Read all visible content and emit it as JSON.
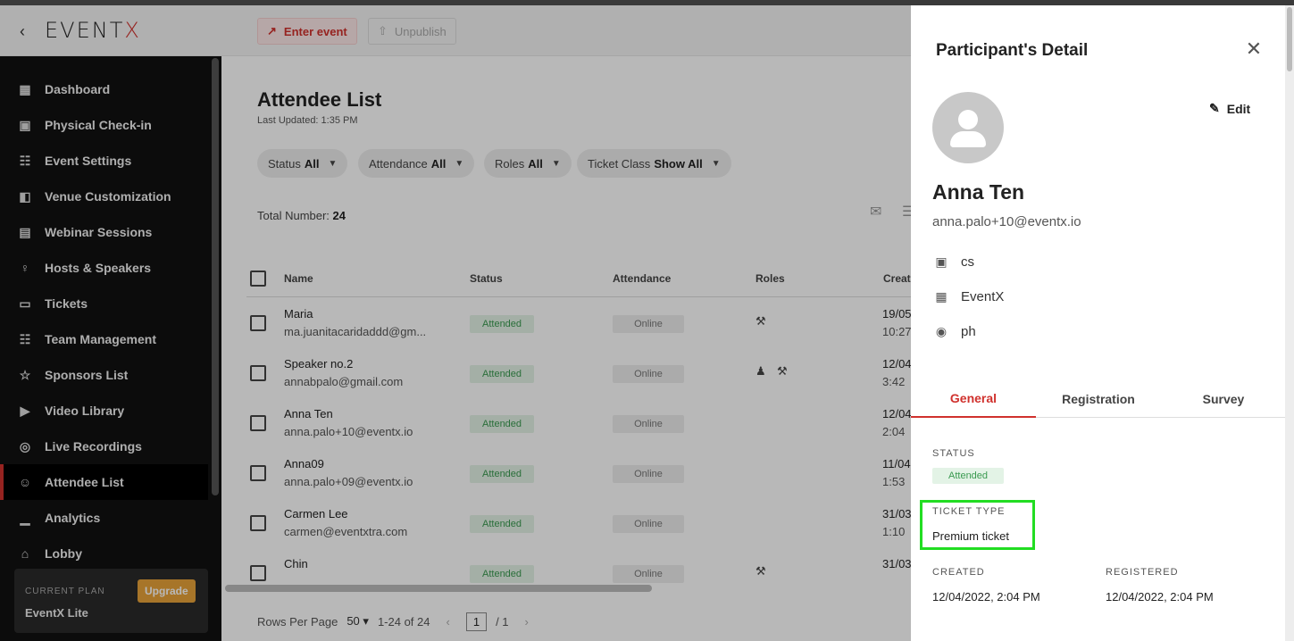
{
  "topbar": {
    "logo_main": "EVENT",
    "logo_x": "X",
    "enter_event_label": "Enter event",
    "unpublish_label": "Unpublish"
  },
  "sidebar": {
    "items": [
      {
        "label": "Dashboard",
        "icon": "dashboard-icon"
      },
      {
        "label": "Physical Check-in",
        "icon": "qr-code-icon"
      },
      {
        "label": "Event Settings",
        "icon": "calendar-settings-icon"
      },
      {
        "label": "Venue Customization",
        "icon": "layout-icon"
      },
      {
        "label": "Webinar Sessions",
        "icon": "calendar-icon"
      },
      {
        "label": "Hosts & Speakers",
        "icon": "microphone-icon"
      },
      {
        "label": "Tickets",
        "icon": "ticket-icon"
      },
      {
        "label": "Team Management",
        "icon": "team-icon"
      },
      {
        "label": "Sponsors List",
        "icon": "sponsor-icon"
      },
      {
        "label": "Video Library",
        "icon": "video-library-icon"
      },
      {
        "label": "Live Recordings",
        "icon": "record-icon"
      },
      {
        "label": "Attendee List",
        "icon": "users-icon"
      },
      {
        "label": "Analytics",
        "icon": "bar-chart-icon"
      },
      {
        "label": "Lobby",
        "icon": "lobby-icon"
      }
    ],
    "active_index": 11,
    "plan_label": "CURRENT PLAN",
    "plan_name": "EventX Lite",
    "upgrade_label": "Upgrade"
  },
  "main": {
    "title": "Attendee List",
    "last_updated": "Last Updated: 1:35 PM",
    "filters": [
      {
        "label": "Status",
        "value": "All"
      },
      {
        "label": "Attendance",
        "value": "All"
      },
      {
        "label": "Roles",
        "value": "All"
      },
      {
        "label": "Ticket Class",
        "value": "Show All"
      }
    ],
    "total_label": "Total Number:",
    "total_value": "24",
    "columns": [
      "Name",
      "Status",
      "Attendance",
      "Roles",
      "Creat"
    ],
    "rows": [
      {
        "name": "Maria",
        "email": "ma.juanitacaridaddd@gm...",
        "status": "Attended",
        "attendance": "Online",
        "roles": [
          "key-icon"
        ],
        "date": "19/05",
        "time": "10:27"
      },
      {
        "name": "Speaker no.2",
        "email": "annabpalo@gmail.com",
        "status": "Attended",
        "attendance": "Online",
        "roles": [
          "speaker-icon",
          "key-icon"
        ],
        "date": "12/04",
        "time": "3:42"
      },
      {
        "name": "Anna Ten",
        "email": "anna.palo+10@eventx.io",
        "status": "Attended",
        "attendance": "Online",
        "roles": [],
        "date": "12/04",
        "time": "2:04"
      },
      {
        "name": "Anna09",
        "email": "anna.palo+09@eventx.io",
        "status": "Attended",
        "attendance": "Online",
        "roles": [],
        "date": "11/04",
        "time": "1:53"
      },
      {
        "name": "Carmen Lee",
        "email": "carmen@eventxtra.com",
        "status": "Attended",
        "attendance": "Online",
        "roles": [],
        "date": "31/03",
        "time": "1:10"
      },
      {
        "name": "Chin",
        "email": "",
        "status": "Attended",
        "attendance": "Online",
        "roles": [
          "key-icon"
        ],
        "date": "31/03",
        "time": ""
      }
    ],
    "pager": {
      "rows_per_page_label": "Rows Per Page",
      "rows_per_page": "50",
      "range": "1-24 of 24",
      "page": "1",
      "of_pages": "/ 1"
    }
  },
  "drawer": {
    "title": "Participant's Detail",
    "edit_label": "Edit",
    "name": "Anna Ten",
    "email": "anna.palo+10@eventx.io",
    "info": [
      {
        "icon": "id-card-icon",
        "value": "cs"
      },
      {
        "icon": "building-icon",
        "value": "EventX"
      },
      {
        "icon": "location-pin-icon",
        "value": "ph"
      }
    ],
    "tabs": [
      "General",
      "Registration",
      "Survey"
    ],
    "active_tab": 0,
    "status_label": "STATUS",
    "status_value": "Attended",
    "ticket_type_label": "TICKET TYPE",
    "ticket_type_value": "Premium ticket",
    "created_label": "CREATED",
    "created_value": "12/04/2022, 2:04 PM",
    "registered_label": "REGISTERED",
    "registered_value": "12/04/2022, 2:04 PM"
  },
  "colors": {
    "accent": "#d0312d",
    "sidebar_bg": "#111111",
    "attended_bg": "#e3f3e6",
    "attended_fg": "#3a9a50",
    "highlight": "#22dd22",
    "upgrade": "#e8a33a"
  }
}
